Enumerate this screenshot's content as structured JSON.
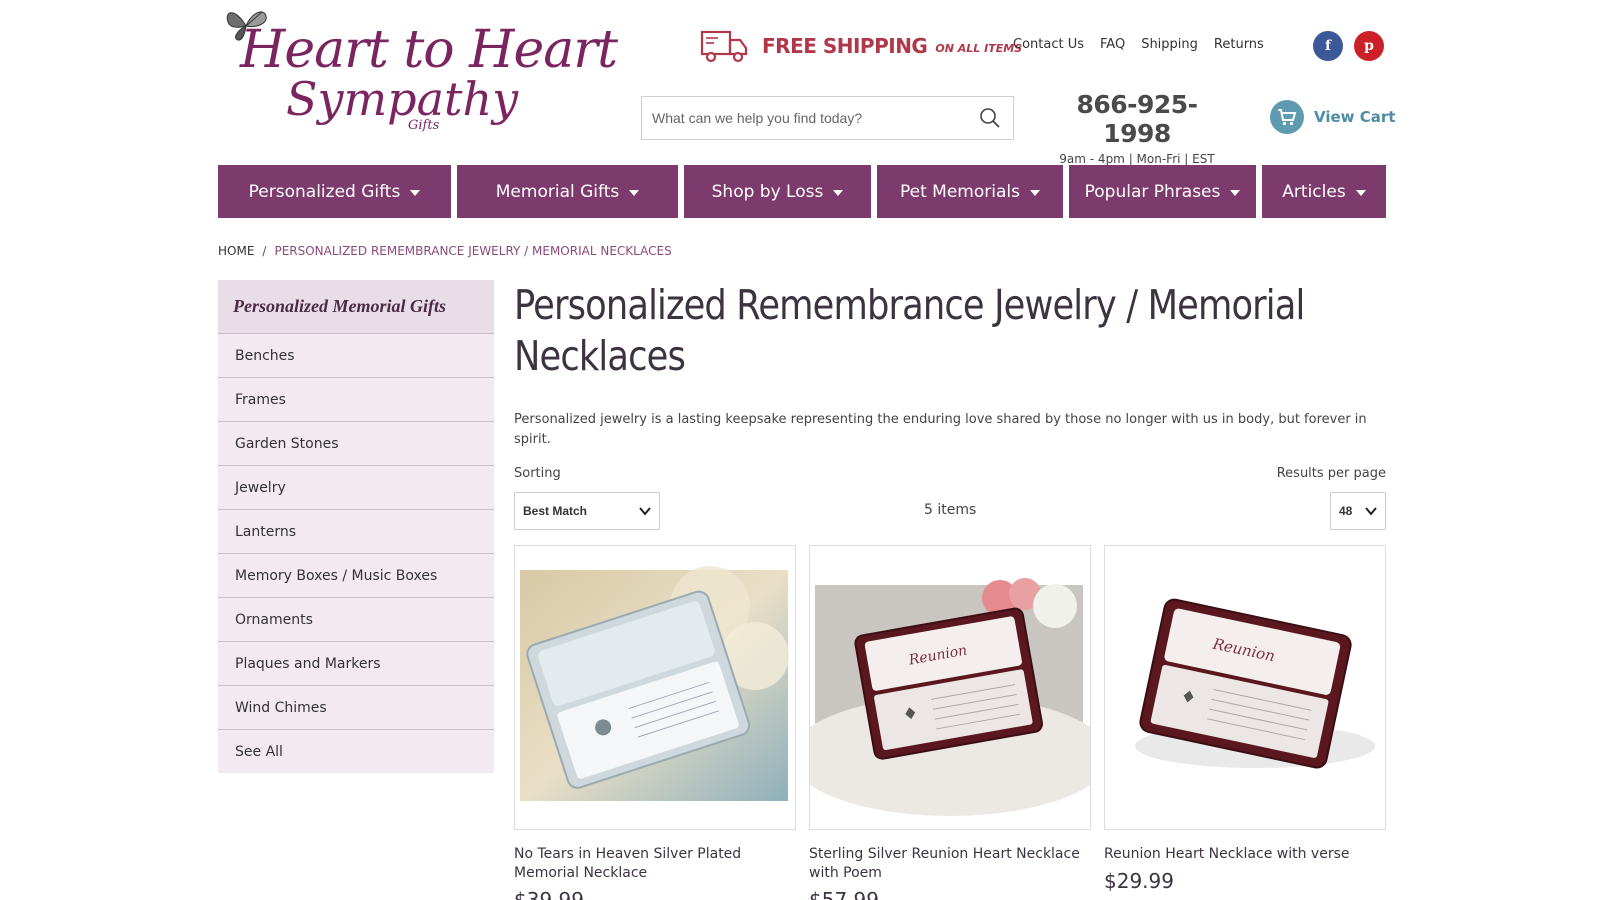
{
  "header": {
    "logo": {
      "line1": "Heart to Heart",
      "line2": "Sympathy",
      "line3": "Gifts"
    },
    "shipping": {
      "main": "FREE SHIPPING",
      "sub": "ON ALL ITEMS"
    },
    "top_links": [
      "Contact Us",
      "FAQ",
      "Shipping",
      "Returns"
    ],
    "social": {
      "facebook": "f",
      "pinterest": "p"
    },
    "search": {
      "placeholder": "What can we help you find today?"
    },
    "phone": {
      "number": "866-925-1998",
      "hours": "9am - 4pm | Mon-Fri | EST"
    },
    "cart": {
      "label": "View Cart"
    }
  },
  "nav": [
    {
      "label": "Personalized Gifts"
    },
    {
      "label": "Memorial Gifts"
    },
    {
      "label": "Shop by Loss"
    },
    {
      "label": "Pet Memorials"
    },
    {
      "label": "Popular Phrases"
    },
    {
      "label": "Articles"
    }
  ],
  "breadcrumb": {
    "home": "Home",
    "separator": "/",
    "current": "Personalized Remembrance Jewelry / Memorial Necklaces"
  },
  "sidebar": {
    "title": "Personalized Memorial Gifts",
    "items": [
      "Benches",
      "Frames",
      "Garden Stones",
      "Jewelry",
      "Lanterns",
      "Memory Boxes / Music Boxes",
      "Ornaments",
      "Plaques and Markers",
      "Wind Chimes",
      "See All"
    ]
  },
  "main": {
    "title": "Personalized Remembrance Jewelry / Memorial Necklaces",
    "description": "Personalized jewelry is a lasting keepsake representing the enduring love shared by those no longer with us in body, but forever in spirit.",
    "sorting_label": "Sorting",
    "sorting_value": "Best Match",
    "item_count": "5 items",
    "rpp_label": "Results per page",
    "rpp_value": "48"
  },
  "products": [
    {
      "name": "No Tears in Heaven Silver Plated Memorial Necklace",
      "price": "$39.99"
    },
    {
      "name": "Sterling Silver Reunion Heart Necklace with Poem",
      "price": "$57.99"
    },
    {
      "name": "Reunion Heart Necklace with verse",
      "price": "$29.99"
    }
  ],
  "colors": {
    "brand_purple": "#7d3a6d",
    "sidebar_bg": "#f2e9f1",
    "promo_red": "#b0384a",
    "cart_blue": "#5e9ab0",
    "facebook": "#3b5998",
    "pinterest": "#cb2027"
  }
}
